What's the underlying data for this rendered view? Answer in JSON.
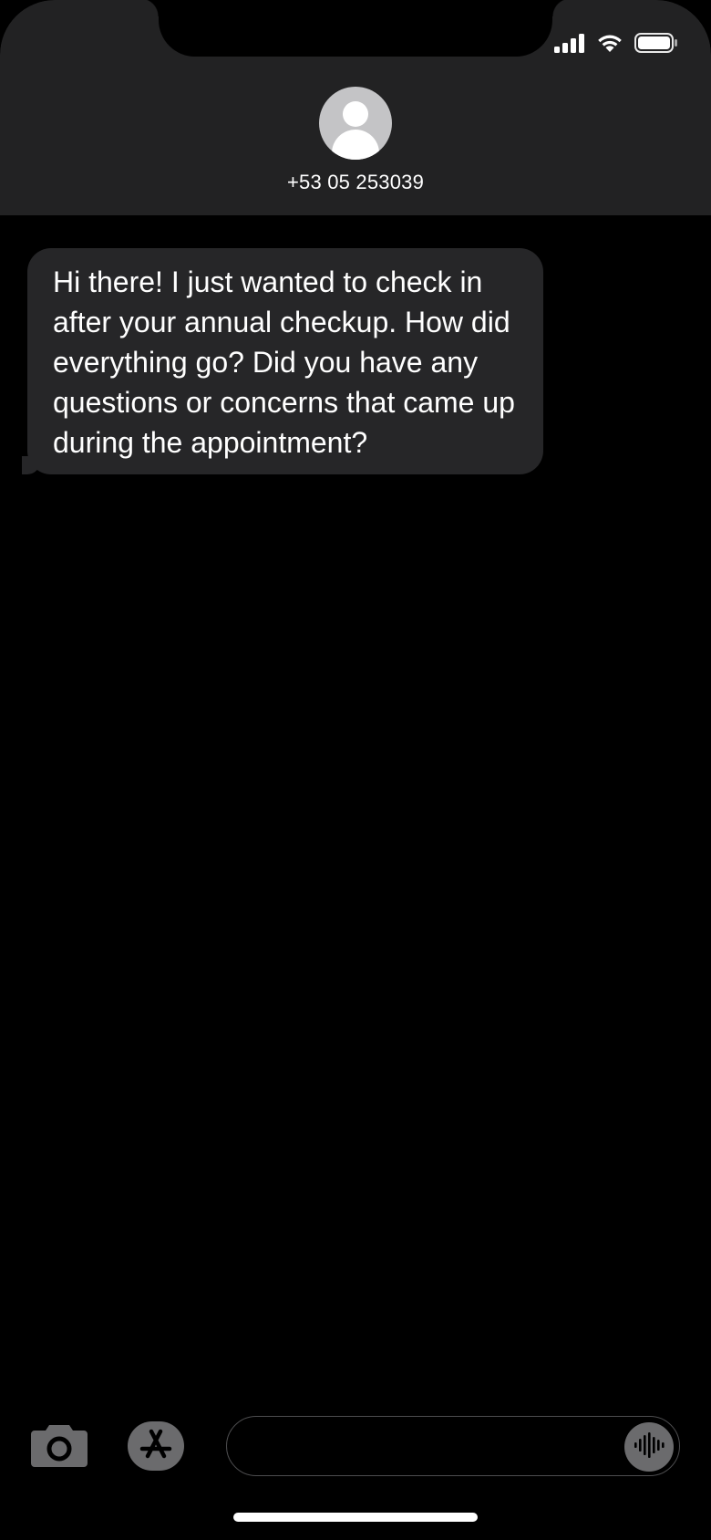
{
  "status_bar": {
    "icons": [
      "cellular-signal-icon",
      "wifi-icon",
      "battery-icon"
    ]
  },
  "contact": {
    "name": "+53 05 253039",
    "avatar_icon": "person-avatar-icon"
  },
  "messages": [
    {
      "direction": "incoming",
      "text": "Hi there! I just wanted to check in after your annual checkup. How did everything go? Did you have any questions or concerns that came up during the appointment?"
    }
  ],
  "composer": {
    "camera_icon": "camera-icon",
    "apps_icon": "app-store-icon",
    "input_value": "",
    "input_placeholder": "",
    "voice_icon": "voice-waveform-icon"
  },
  "colors": {
    "header_bg": "#222223",
    "bubble_incoming": "#262628",
    "background": "#000000",
    "button_gray": "#6b6b6d"
  }
}
